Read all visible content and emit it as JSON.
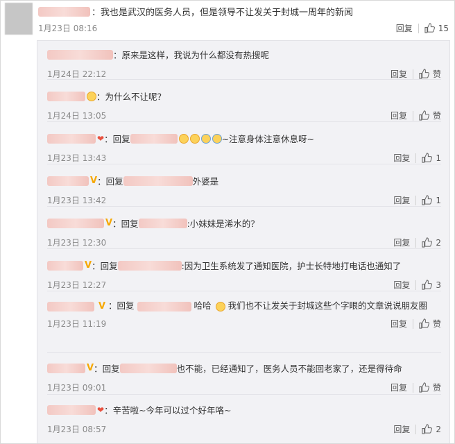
{
  "top": {
    "text": "：我也是武汉的医务人员，但是领导不让发关于封城一周年的新闻",
    "time": "1月23日 08:16",
    "reply_label": "回复",
    "likes": "15"
  },
  "replies": [
    {
      "text": "：原来是这样，我说为什么都没有热搜呢",
      "time": "1月24日 22:12",
      "reply_label": "回复",
      "likes": "赞"
    },
    {
      "text": "：为什么不让呢？",
      "time": "1月24日 13:05",
      "reply_label": "回复",
      "likes": "赞"
    },
    {
      "prefix": "：回复",
      "text": "~注意身体注意休息呀~",
      "time": "1月23日 13:43",
      "reply_label": "回复",
      "likes": "1"
    },
    {
      "prefix": "：回复",
      "text": "外婆是",
      "time": "1月23日 13:42",
      "reply_label": "回复",
      "likes": "1"
    },
    {
      "prefix": "：回复",
      "text": ":小妹妹是浠水的？",
      "time": "1月23日 12:30",
      "reply_label": "回复",
      "likes": "2"
    },
    {
      "prefix": "：回复",
      "text": ":因为卫生系统发了通知医院，护士长特地打电话也通知了",
      "time": "1月23日 12:27",
      "reply_label": "回复",
      "likes": "3"
    },
    {
      "prefix": "：回复",
      "text": "哈哈",
      "text2": "我们也不让发关于封城这些个字眼的文章说说朋友圈",
      "time": "1月23日 11:19",
      "reply_label": "回复",
      "likes": "赞"
    },
    {
      "prefix": "：回复",
      "text": "也不能，已经通知了，医务人员不能回老家了，还是得待命",
      "time": "1月23日 09:01",
      "reply_label": "回复",
      "likes": "赞"
    },
    {
      "text": "：辛苦啦~今年可以过个好年咯~",
      "time": "1月23日 08:57",
      "reply_label": "回复",
      "likes": "2"
    }
  ]
}
